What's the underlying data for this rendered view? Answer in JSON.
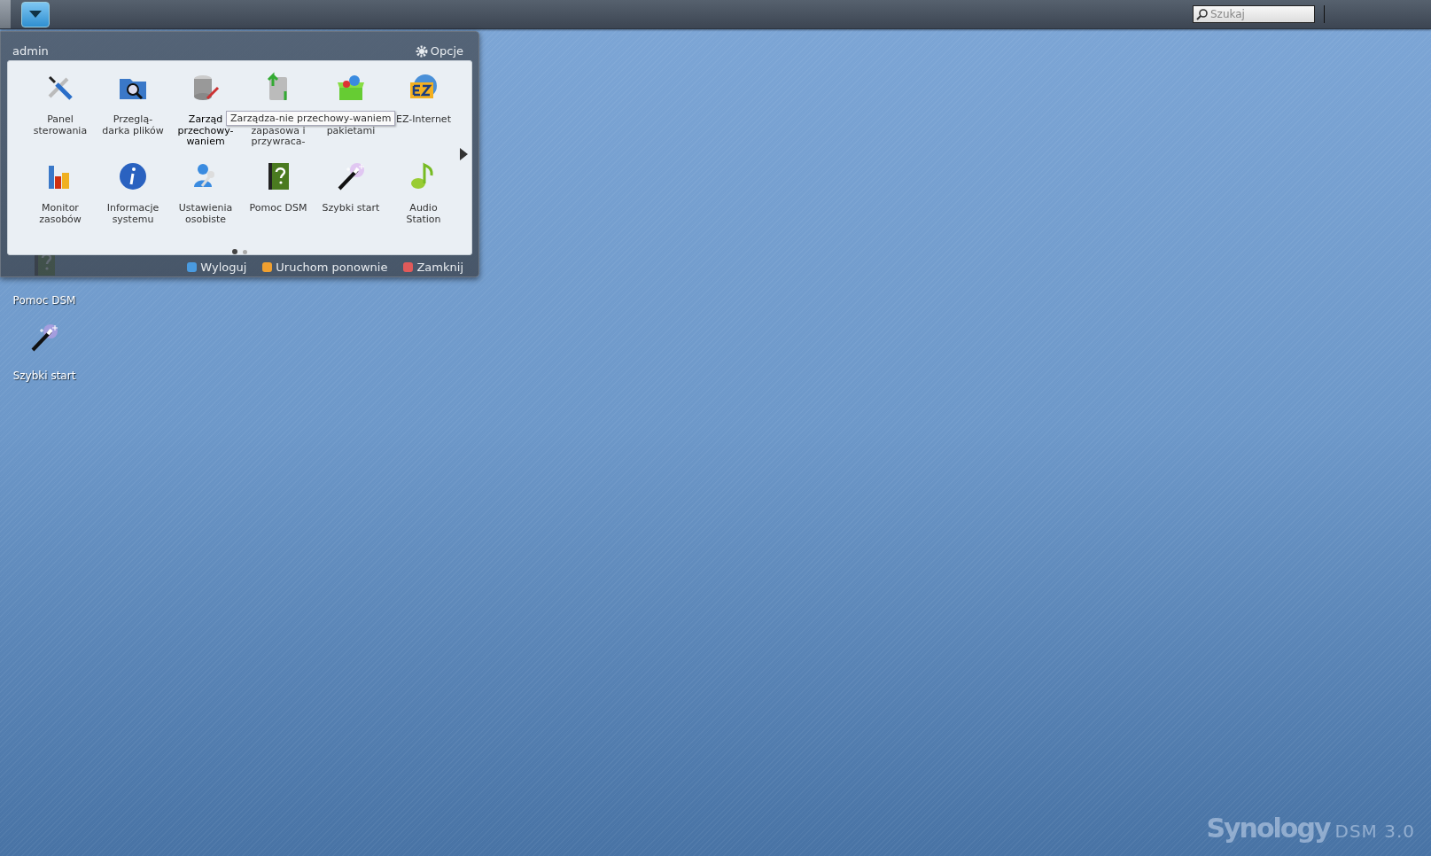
{
  "taskbar": {
    "search": {
      "placeholder": "Szukaj"
    }
  },
  "desktop": {
    "icons": [
      {
        "kind": "help",
        "label": "Pomoc DSM"
      },
      {
        "kind": "wand",
        "label": "Szybki start"
      }
    ]
  },
  "main_menu": {
    "user": "admin",
    "options": "Opcje",
    "apps": [
      {
        "kind": "tools",
        "lines": [
          "Panel",
          "sterowania"
        ],
        "hovered": false,
        "first_line_covered": false
      },
      {
        "kind": "folder",
        "lines": [
          "Przeglą-",
          "darka plików"
        ],
        "hovered": false,
        "first_line_covered": false
      },
      {
        "kind": "storage",
        "lines": [
          "Zarząd",
          "przechowy-",
          "waniem"
        ],
        "hovered": true,
        "first_line_covered": false
      },
      {
        "kind": "backup",
        "lines": [
          "zapasowa i",
          "przywraca-"
        ],
        "hovered": false,
        "first_line_covered": true
      },
      {
        "kind": "package",
        "lines": [
          "pakietami"
        ],
        "hovered": false,
        "first_line_covered": true
      },
      {
        "kind": "ez",
        "lines": [
          "EZ-Internet"
        ],
        "hovered": false,
        "first_line_covered": false
      },
      {
        "kind": "monitor",
        "lines": [
          "Monitor",
          "zasobów"
        ],
        "hovered": false,
        "first_line_covered": false
      },
      {
        "kind": "info",
        "lines": [
          "Informacje",
          "systemu"
        ],
        "hovered": false,
        "first_line_covered": false
      },
      {
        "kind": "user",
        "lines": [
          "Ustawienia",
          "osobiste"
        ],
        "hovered": false,
        "first_line_covered": false
      },
      {
        "kind": "help",
        "lines": [
          "Pomoc DSM"
        ],
        "hovered": false,
        "first_line_covered": false
      },
      {
        "kind": "wand",
        "lines": [
          "Szybki start"
        ],
        "hovered": false,
        "first_line_covered": false
      },
      {
        "kind": "music",
        "lines": [
          "Audio",
          "Station"
        ],
        "hovered": false,
        "first_line_covered": false
      }
    ],
    "tooltip": "Zarządza-nie przechowy-waniem",
    "pages": [
      {
        "selected": true
      },
      {
        "selected": false
      }
    ],
    "actions": [
      {
        "label": "Wyloguj",
        "color": "#4a9be0"
      },
      {
        "label": "Uruchom ponownie",
        "color": "#f0a030"
      },
      {
        "label": "Zamknij",
        "color": "#e05a5a"
      }
    ]
  },
  "logo": {
    "brand": "Synology",
    "product": "DSM 3.0"
  }
}
